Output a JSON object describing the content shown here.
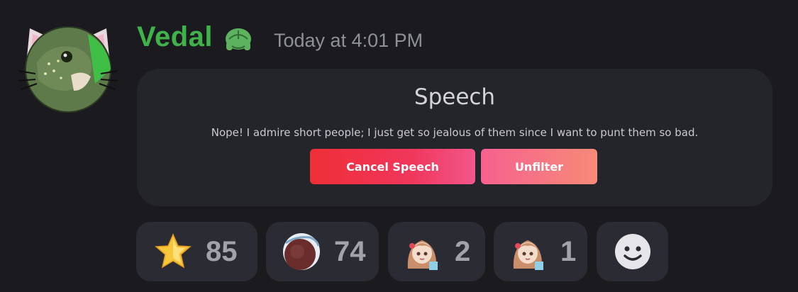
{
  "message": {
    "username": "Vedal",
    "timestamp": "Today at 4:01 PM",
    "username_color": "#3fb24a",
    "avatar_icon": "turtle-cat-avatar",
    "badge_icon": "turtle-icon"
  },
  "card": {
    "title": "Speech",
    "text": "Nope! I admire short people; I just get so jealous of them since I want to punt them so bad.",
    "cancel_label": "Cancel Speech",
    "unfilter_label": "Unfilter"
  },
  "reactions": [
    {
      "icon": "star-icon",
      "count": "85"
    },
    {
      "icon": "custom-emoji-icon",
      "count": "74"
    },
    {
      "icon": "anime-girl-emoji-icon",
      "count": "2"
    },
    {
      "icon": "anime-girl-emoji-icon",
      "count": "1"
    },
    {
      "icon": "add-reaction-smiley-icon"
    }
  ],
  "colors": {
    "background": "#1b1b1f",
    "card": "#24242b",
    "reaction_bg": "#2b2c33",
    "cancel_button": "#ee2f37",
    "unfilter_button": "#f6618f"
  }
}
